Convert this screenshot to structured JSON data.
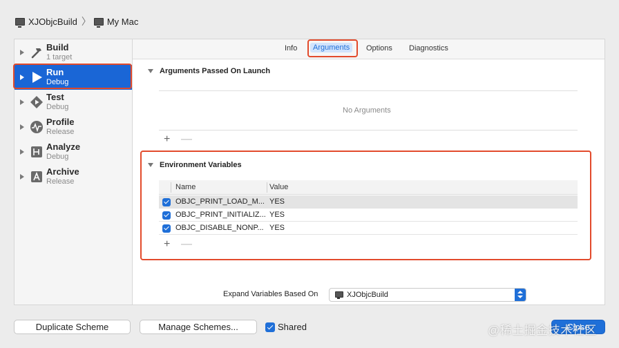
{
  "breadcrumb": {
    "scheme": "XJObjcBuild",
    "separator": "〉",
    "destination": "My Mac"
  },
  "sidebar": {
    "items": [
      {
        "title": "Build",
        "subtitle": "1 target",
        "icon": "hammer-icon",
        "selected": false
      },
      {
        "title": "Run",
        "subtitle": "Debug",
        "icon": "play-icon",
        "selected": true
      },
      {
        "title": "Test",
        "subtitle": "Debug",
        "icon": "diamond-play-icon",
        "selected": false
      },
      {
        "title": "Profile",
        "subtitle": "Release",
        "icon": "waveform-icon",
        "selected": false
      },
      {
        "title": "Analyze",
        "subtitle": "Debug",
        "icon": "analyze-icon",
        "selected": false
      },
      {
        "title": "Archive",
        "subtitle": "Release",
        "icon": "archive-icon",
        "selected": false
      }
    ]
  },
  "tabs": [
    {
      "label": "Info",
      "active": false
    },
    {
      "label": "Arguments",
      "active": true
    },
    {
      "label": "Options",
      "active": false
    },
    {
      "label": "Diagnostics",
      "active": false
    }
  ],
  "arguments_section": {
    "title": "Arguments Passed On Launch",
    "empty_text": "No Arguments",
    "add_label": "+",
    "remove_label": "—"
  },
  "env_section": {
    "title": "Environment Variables",
    "columns": {
      "name": "Name",
      "value": "Value"
    },
    "rows": [
      {
        "name": "OBJC_PRINT_LOAD_M...",
        "value": "YES",
        "checked": true
      },
      {
        "name": "OBJC_PRINT_INITIALIZ...",
        "value": "YES",
        "checked": true
      },
      {
        "name": "OBJC_DISABLE_NONP...",
        "value": "YES",
        "checked": true
      }
    ],
    "add_label": "+",
    "remove_label": "—"
  },
  "expand": {
    "label": "Expand Variables Based On",
    "selected": "XJObjcBuild"
  },
  "footer": {
    "duplicate": "Duplicate Scheme",
    "manage": "Manage Schemes...",
    "shared_label": "Shared",
    "shared_checked": true,
    "close": "Close",
    "watermark": "@稀土掘金技术社区"
  },
  "colors": {
    "accent": "#1f6fd8",
    "selection": "#1a66d6",
    "highlight": "#e24a2b"
  }
}
